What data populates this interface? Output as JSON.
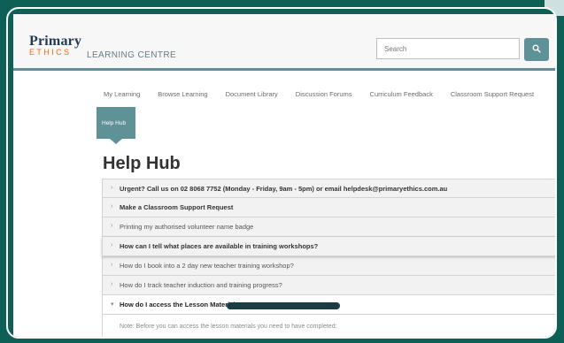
{
  "header": {
    "logo_primary": "Primary",
    "logo_ethics": "ETHICS",
    "logo_centre": "LEARNING CENTRE",
    "search_placeholder": "Search"
  },
  "nav": {
    "items": [
      {
        "label": "My Learning"
      },
      {
        "label": "Browse Learning"
      },
      {
        "label": "Document Library"
      },
      {
        "label": "Discussion Forums"
      },
      {
        "label": "Curriculum Feedback"
      },
      {
        "label": "Classroom Support Request"
      }
    ],
    "active_tab": "Help Hub"
  },
  "page": {
    "title": "Help Hub"
  },
  "accordion": {
    "items": [
      {
        "label": "Urgent? Call us on 02 8068 7752 (Monday - Friday, 9am - 5pm) or email helpdesk@primaryethics.com.au"
      },
      {
        "label": "Make a Classroom Support Request"
      },
      {
        "label": "Printing my authorised volunteer name badge"
      },
      {
        "label": "How can I tell what places are available in training workshops?"
      },
      {
        "label": "How do I book into a 2 day new teacher training workshop?"
      },
      {
        "label": "How do I track teacher induction and training progress?"
      },
      {
        "label": "How do I access the Lesson Materials?"
      }
    ],
    "open_note": "Note: Before you can access the lesson materials you need to have completed:"
  },
  "icons": {
    "search": "search-icon",
    "collapsed": "chevron-right-icon",
    "expanded": "chevron-down-icon"
  },
  "colors": {
    "background": "#0e5f55",
    "accent": "#5f9297",
    "brand_orange": "#ea6b1f",
    "brand_navy": "#203a55"
  }
}
